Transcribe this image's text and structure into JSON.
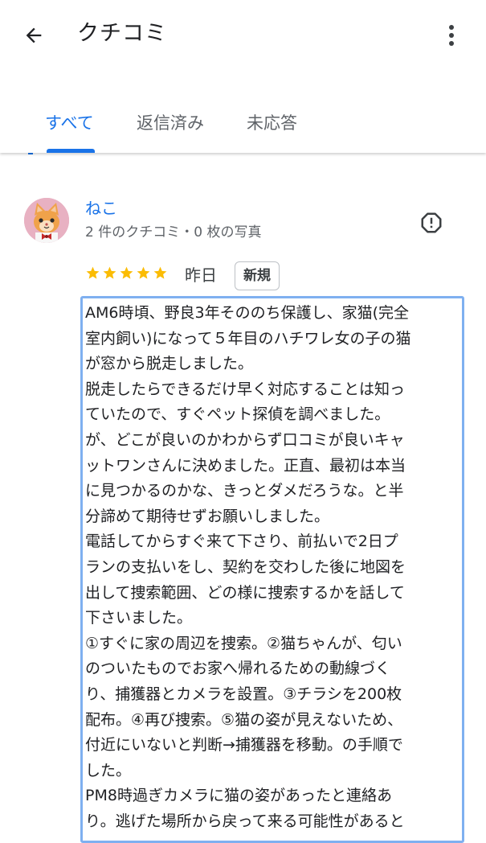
{
  "header": {
    "title": "クチコミ",
    "back_icon": "arrow-back-icon",
    "more_icon": "more-vert-icon"
  },
  "tabs": [
    {
      "label": "すべて",
      "active": true
    },
    {
      "label": "返信済み",
      "active": false
    },
    {
      "label": "未応答",
      "active": false
    }
  ],
  "colors": {
    "accent": "#1a73e8",
    "star": "#fbbc04",
    "text_border": "#7fb0f0"
  },
  "review": {
    "author": "ねこ",
    "meta": "2 件のクチコミ・0 枚の写真",
    "rating": 5,
    "max_rating": 5,
    "date": "昨日",
    "badge": "新規",
    "flag_icon": "report-flag-icon",
    "text_lines": [
      "AM6時頃、野良3年そののち保護し、家猫(完全",
      "室内飼い)になって５年目のハチワレ女の子の猫",
      "が窓から脱走しました。",
      "脱走したらできるだけ早く対応することは知っ",
      "ていたので、すぐペット探偵を調べました。",
      "が、どこが良いのかわからず口コミが良いキャ",
      "ットワンさんに決めました。正直、最初は本当",
      "に見つかるのかな、きっとダメだろうな。と半",
      "分諦めて期待せずお願いしました。",
      "電話してからすぐ来て下さり、前払いで2日プ",
      "ランの支払いをし、契約を交わした後に地図を",
      "出して捜索範囲、どの様に捜索するかを話して",
      "下さいました。",
      "①すぐに家の周辺を捜索。②猫ちゃんが、匂い",
      "のついたものでお家へ帰れるための動線づく",
      "り、捕獲器とカメラを設置。③チラシを200枚",
      "配布。④再び捜索。⑤猫の姿が見えないため、",
      "付近にいないと判断→捕獲器を移動。の手順で",
      "した。",
      "PM8時過ぎカメラに猫の姿があったと連絡あ",
      "り。逃げた場所から戻って来る可能性があると"
    ]
  }
}
